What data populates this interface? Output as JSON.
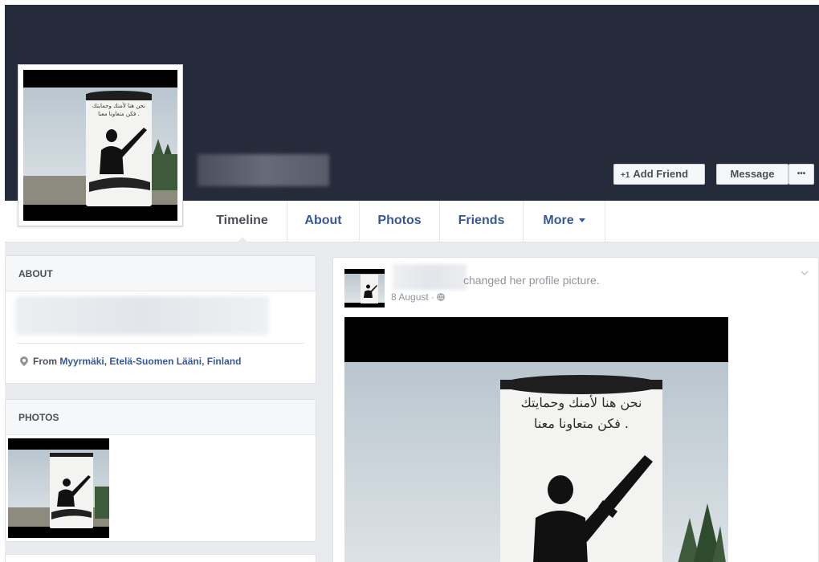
{
  "profile": {
    "cover_color": "#262b3b"
  },
  "actions": {
    "add_friend_label": "Add Friend",
    "message_label": "Message",
    "more_label": "•••"
  },
  "tabs": [
    {
      "label": "Timeline",
      "active": true
    },
    {
      "label": "About"
    },
    {
      "label": "Photos"
    },
    {
      "label": "Friends"
    },
    {
      "label": "More"
    }
  ],
  "about": {
    "header": "ABOUT",
    "from_prefix": "From",
    "from_place": "Myyrmäki, Etelä-Suomen Lääni, Finland"
  },
  "photos": {
    "header": "PHOTOS"
  },
  "post": {
    "action_text": "changed her profile picture.",
    "date": "8 August ·"
  },
  "photo_caption": {
    "line1": "نحن هنا لأمنك وحمايتك",
    "line2": "فكن متعاونا معنا ."
  },
  "icons": {
    "add_friend": "add-friend-icon",
    "location": "location-pin-icon",
    "globe": "globe-icon",
    "chevron": "chevron-down-icon"
  }
}
